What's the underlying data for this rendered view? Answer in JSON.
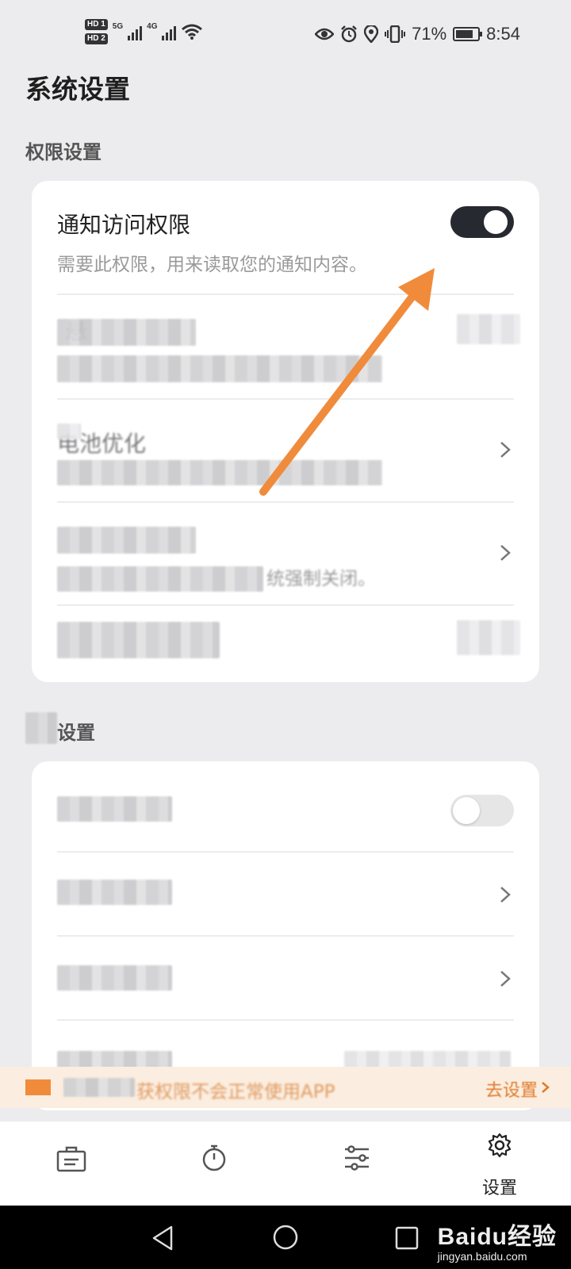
{
  "status_bar": {
    "sim1": "HD 1",
    "sim2": "HD 2",
    "net1": "5G",
    "net2": "4G",
    "battery": "71%",
    "time": "8:54"
  },
  "page": {
    "title": "系统设置"
  },
  "sections": [
    {
      "label": "权限设置",
      "rows": [
        {
          "title": "通知访问权限",
          "desc": "需要此权限，用来读取您的通知内容。",
          "control": "toggle",
          "state": "on"
        },
        {
          "title": "悬",
          "desc": "",
          "control": "toggle",
          "state": "blurred"
        },
        {
          "title": "电池优化",
          "desc": "",
          "control": "chevron"
        },
        {
          "title": "",
          "desc": "统强制关闭。",
          "control": "chevron"
        },
        {
          "title": "",
          "desc": "",
          "control": "toggle",
          "state": "blurred"
        }
      ]
    },
    {
      "label": "设置",
      "rows": [
        {
          "title": "",
          "control": "toggle",
          "state": "off"
        },
        {
          "title": "",
          "control": "chevron"
        },
        {
          "title": "",
          "control": "chevron"
        },
        {
          "title": "",
          "control": "none"
        }
      ]
    }
  ],
  "banner": {
    "text": "获权限不会正常使用APP",
    "action": "去设置",
    "accent": "#f08b3c"
  },
  "tabs": [
    {
      "icon": "briefcase-icon",
      "label": ""
    },
    {
      "icon": "stopwatch-icon",
      "label": ""
    },
    {
      "icon": "sliders-icon",
      "label": ""
    },
    {
      "icon": "gear-icon",
      "label": "设置",
      "active": true
    }
  ],
  "watermark": {
    "brand": "Baidu经验",
    "url": "jingyan.baidu.com"
  },
  "colors": {
    "arrow": "#f08b3c",
    "toggle_on": "#262a30",
    "background": "#ececee"
  }
}
